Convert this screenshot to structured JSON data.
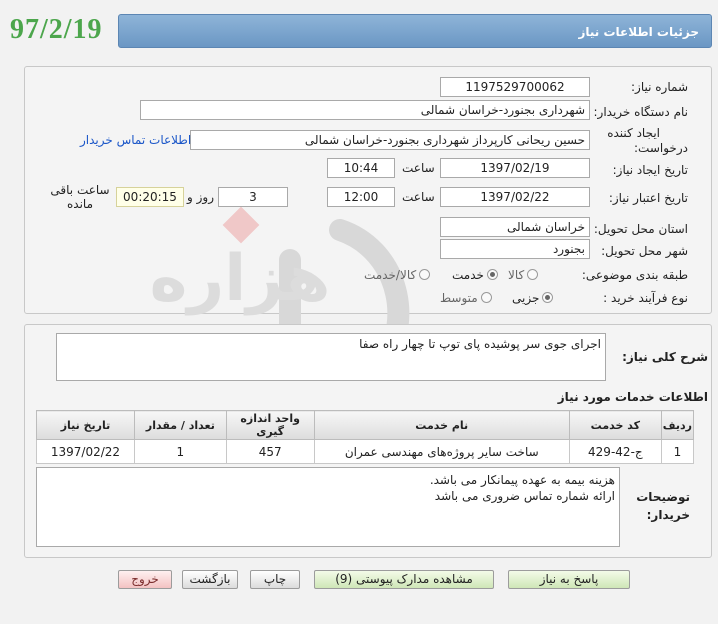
{
  "stamp": "97/2/19",
  "header": {
    "title": "جزئیات اطلاعات نیاز"
  },
  "watermark": {
    "brand_main": "هزاره",
    "brand_sub": "گستران",
    "brand_tail": "ارتباط"
  },
  "form": {
    "need_number": {
      "label": "شماره نیاز:",
      "value": "1197529700062"
    },
    "buyer_org": {
      "label": "نام دستگاه خریدار:",
      "value": "شهرداری بجنورد-خراسان شمالی"
    },
    "creator": {
      "label_line1": "ایجاد کننده",
      "label_line2": "درخواست:",
      "value": "حسین ریحانی کارپرداز شهرداری بجنورد-خراسان شمالی",
      "contact_link": "اطلاعات تماس خریدار"
    },
    "create_date": {
      "label": "تاریخ ایجاد نیاز:",
      "date": "1397/02/19",
      "time_label": "ساعت",
      "time": "10:44"
    },
    "validity": {
      "label": "تاریخ اعتبار نیاز:",
      "date": "1397/02/22",
      "time_label": "ساعت",
      "time": "12:00",
      "days": "3",
      "days_label": "روز و",
      "remaining": "00:20:15",
      "remaining_label": "ساعت باقی مانده"
    },
    "province": {
      "label": "استان محل تحویل:",
      "value": "خراسان شمالی"
    },
    "city": {
      "label": "شهر محل تحویل:",
      "value": "بجنورد"
    },
    "category": {
      "label": "طبقه بندی موضوعی:",
      "options": [
        "کالا",
        "خدمت",
        "کالا/خدمت"
      ],
      "selected": "خدمت"
    },
    "process": {
      "label": "نوع فرآیند خرید :",
      "options": [
        "جزیی",
        "متوسط"
      ],
      "selected": "جزیی"
    }
  },
  "summary": {
    "label": "شرح کلی نیاز:",
    "value": "اجرای جوی سر پوشیده پای توپ تا چهار راه صفا"
  },
  "services": {
    "title": "اطلاعات خدمات مورد نیاز",
    "columns": [
      "ردیف",
      "کد خدمت",
      "نام خدمت",
      "واحد اندازه گیری",
      "تعداد / مقدار",
      "تاریخ نیاز"
    ],
    "rows": [
      [
        "1",
        "ج-42-429",
        "ساخت سایر پروژه‌های مهندسی عمران",
        "457",
        "1",
        "1397/02/22"
      ]
    ]
  },
  "notes": {
    "label_line1": "توضیحات",
    "label_line2": "خریدار:",
    "line1": "هزینه بیمه به عهده پیمانکار می باشد.",
    "line2": "ارائه شماره تماس ضروری می باشد"
  },
  "buttons": {
    "reply": "پاسخ به نیاز",
    "attachments": "مشاهده مدارک پیوستی (9)",
    "print": "چاپ",
    "back": "بازگشت",
    "exit": "خروج"
  }
}
